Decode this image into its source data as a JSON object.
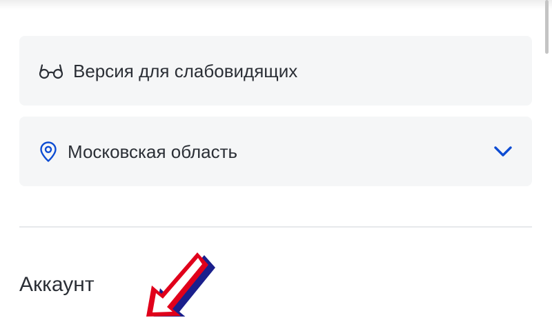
{
  "menu": {
    "accessibility_label": "Версия для слабовидящих",
    "accessibility_icon": "glasses-icon",
    "region_label": "Московская область",
    "region_icon": "location-pin-icon",
    "region_chevron_icon": "chevron-down-icon"
  },
  "account": {
    "section_title": "Аккаунт"
  },
  "colors": {
    "card_background": "#f5f6f7",
    "text": "#2b2f36",
    "accent_blue": "#0d4cd3",
    "annotation_red": "#e0001b",
    "annotation_navy": "#1a1f8c"
  }
}
